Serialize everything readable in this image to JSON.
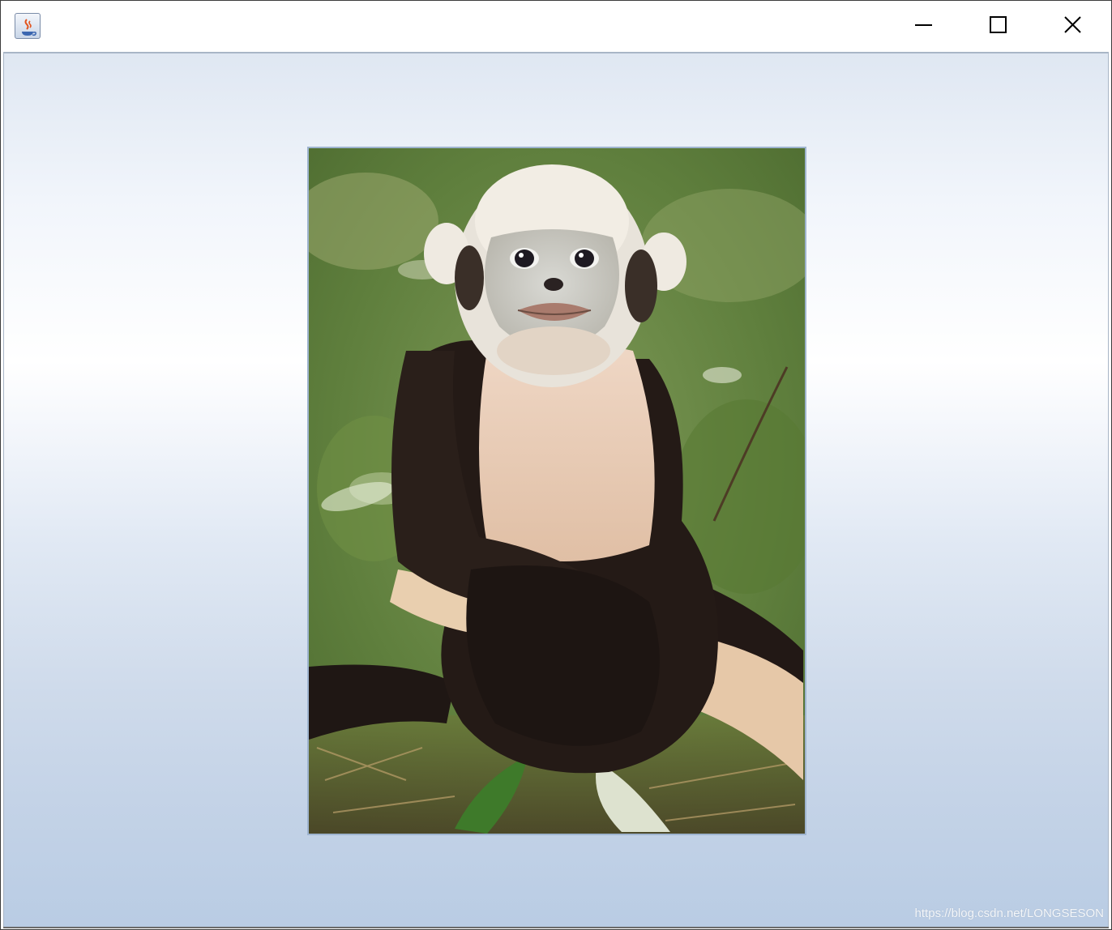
{
  "window": {
    "title": "",
    "controls": {
      "minimize_icon": "minimize-icon",
      "maximize_icon": "maximize-icon",
      "close_icon": "close-icon"
    },
    "app_icon": "java-coffee-cup-icon"
  },
  "content": {
    "image_subject": "monkey-photo",
    "background_colors": [
      "#dfe7f2",
      "#ffffff",
      "#b9cce4"
    ]
  },
  "watermark": {
    "text": "https://blog.csdn.net/LONGSESON"
  }
}
